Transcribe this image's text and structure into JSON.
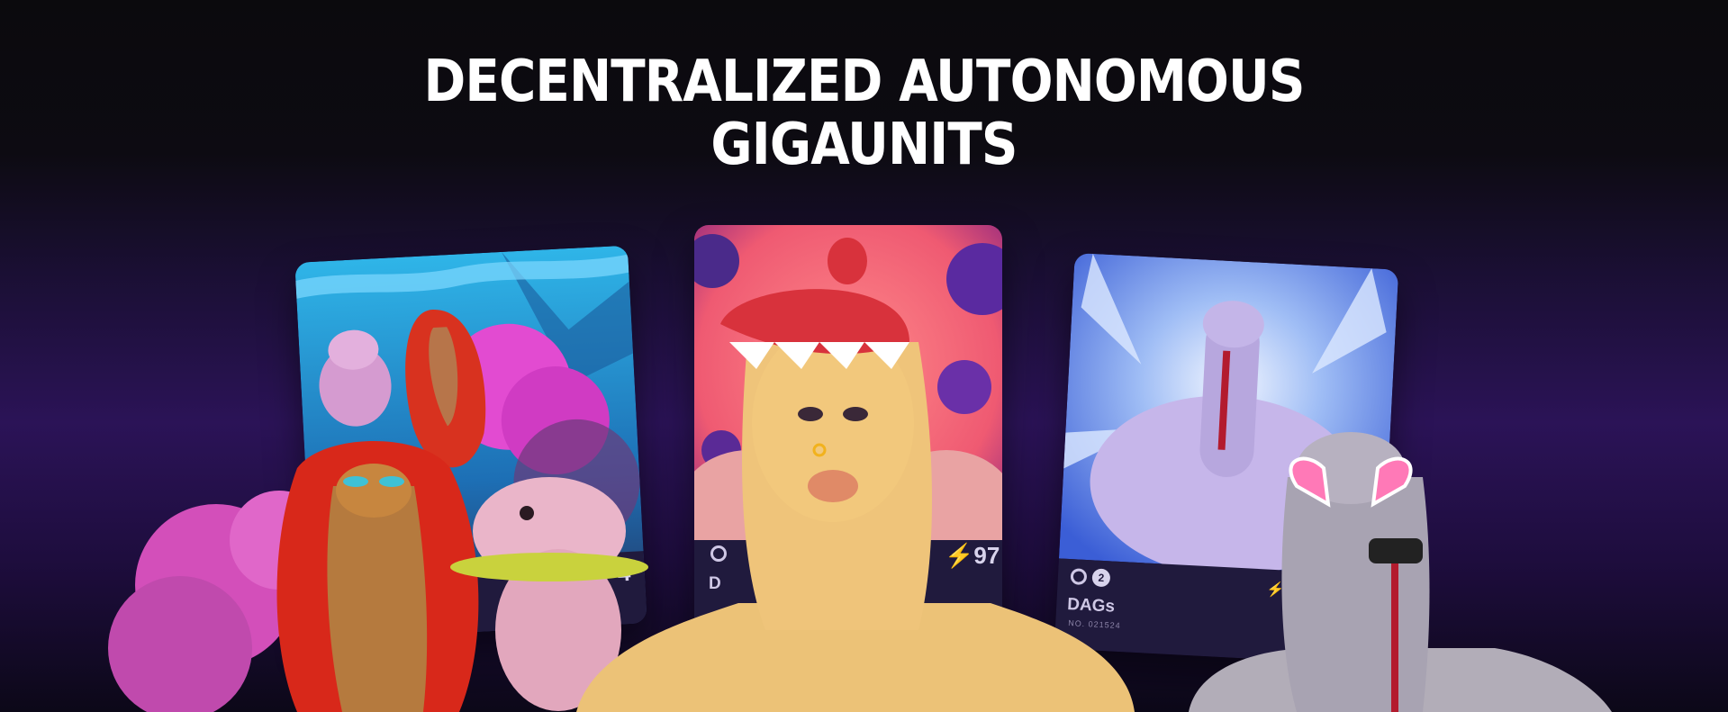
{
  "hero": {
    "title_line1": "DECENTRALIZED AUTONOMOUS",
    "title_line2": "GIGAUNITS"
  },
  "cards": [
    {
      "id": "left",
      "power_partial": "4",
      "icons": [
        "gear-icon"
      ]
    },
    {
      "id": "center",
      "name_partial": "D",
      "power": "97",
      "power_icon": "lightning-icon",
      "icons": [
        "gear-icon"
      ]
    },
    {
      "id": "right",
      "name": "DAGs",
      "number": "NO. 021524",
      "badge": "2",
      "icons": [
        "gear-icon",
        "badge-icon",
        "lightning-icon"
      ]
    }
  ],
  "colors": {
    "background_top": "#0b0a0d",
    "background_purple": "#2b1357",
    "card_footer": "#201a3d",
    "left_card_sky": "#2a9bd8",
    "center_card_pink": "#ef5a72",
    "right_card_ice": "#5b78e0"
  }
}
